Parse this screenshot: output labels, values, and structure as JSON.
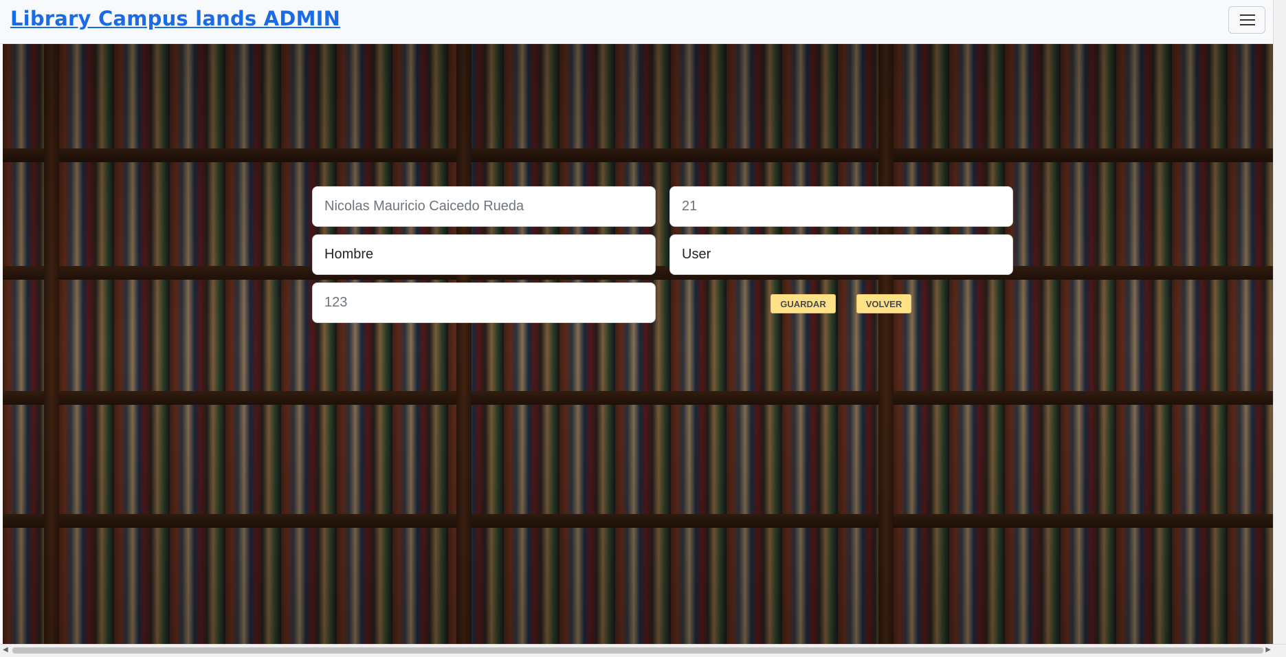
{
  "navbar": {
    "brand": "Library Campus lands ADMIN",
    "menu_icon": "hamburger-icon"
  },
  "form": {
    "nombre": {
      "value": "Nicolas Mauricio Caicedo Rueda",
      "style": "placeholder"
    },
    "edad": {
      "value": "21",
      "style": "placeholder"
    },
    "genero": {
      "value": "Hombre",
      "style": "value"
    },
    "rol": {
      "value": "User",
      "style": "value"
    },
    "password": {
      "value": "123",
      "style": "placeholder"
    },
    "guardar_label": "GUARDAR",
    "volver_label": "VOLVER"
  },
  "colors": {
    "brand": "#1a6be6",
    "button": "#ffe187",
    "navbar_bg": "#f8f9fa"
  }
}
